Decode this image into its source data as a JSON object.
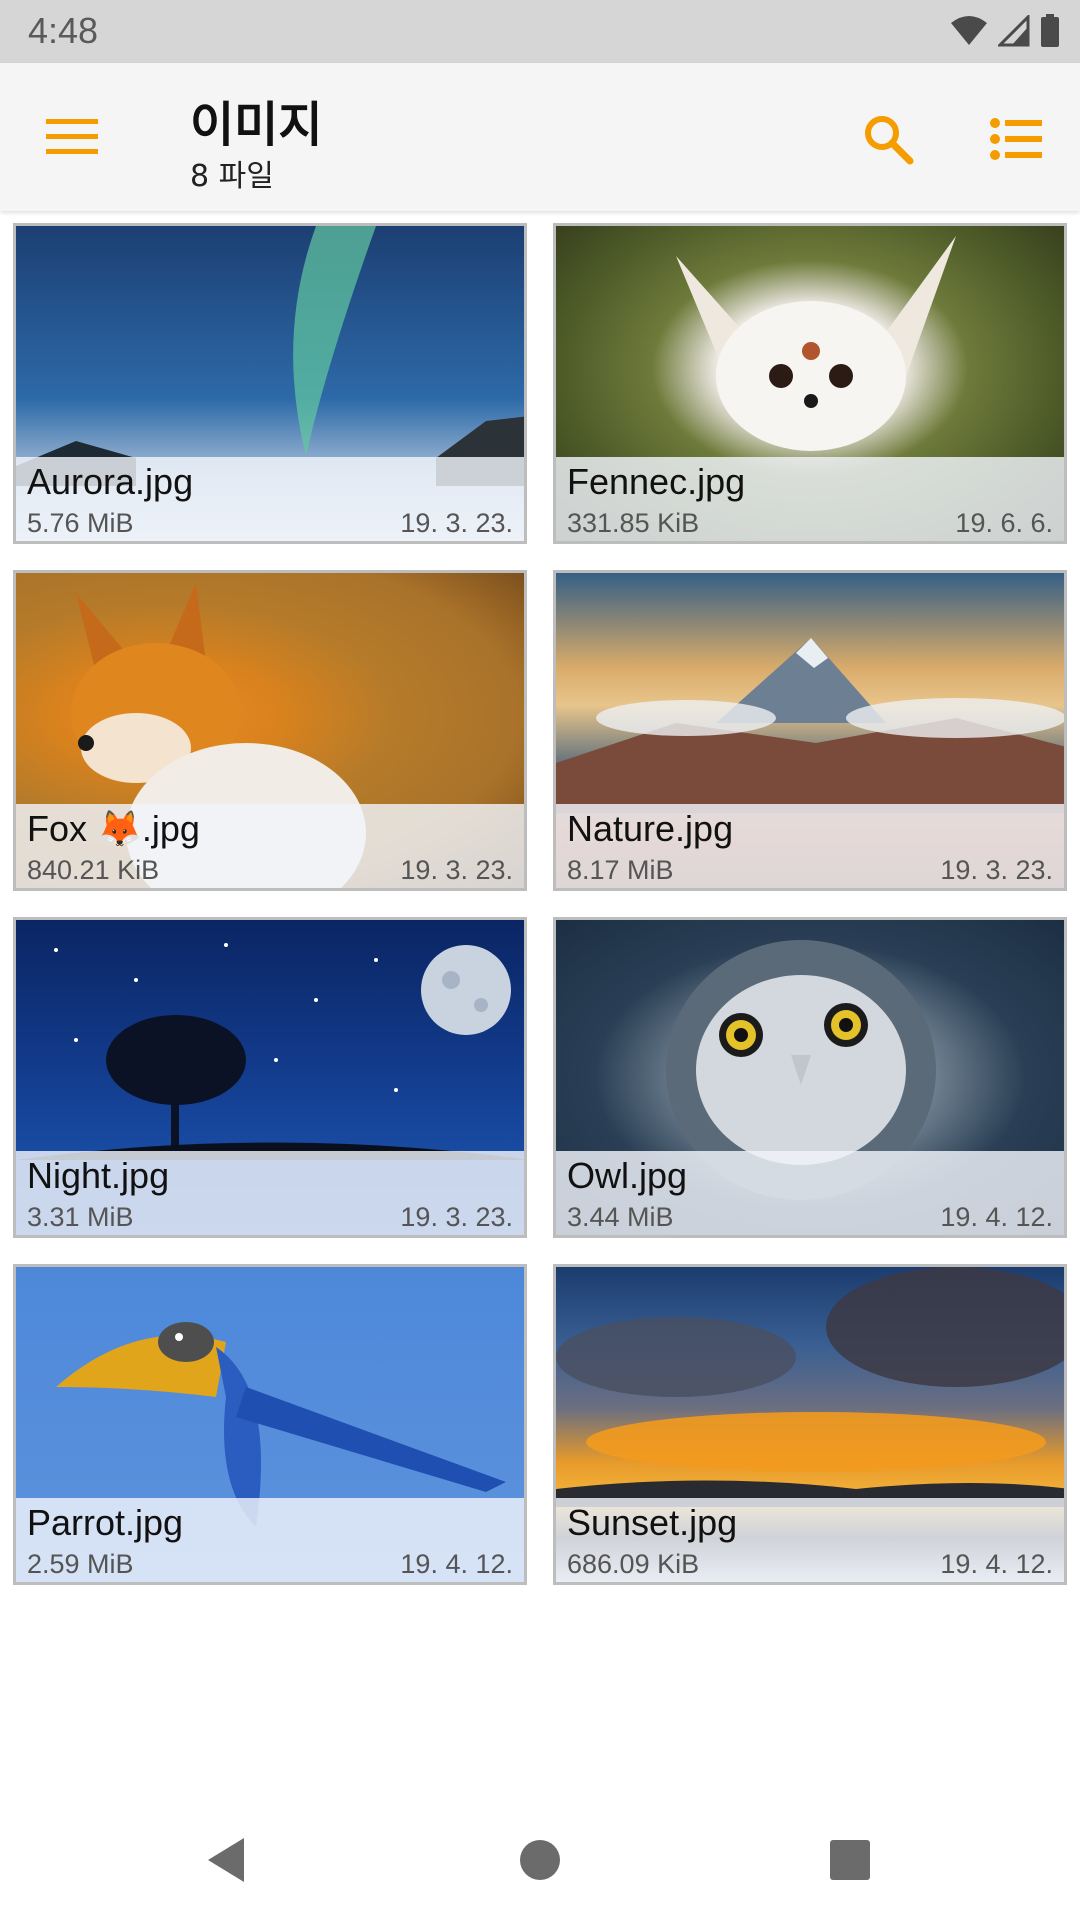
{
  "status_bar": {
    "time": "4:48",
    "icons": [
      "wifi-icon",
      "cell-signal-icon",
      "battery-icon"
    ]
  },
  "app_bar": {
    "title": "이미지",
    "subtitle": "8 파일",
    "accent_color": "#f59c00",
    "icons": [
      "menu-icon",
      "search-icon",
      "list-view-icon"
    ]
  },
  "files": [
    {
      "name": "Aurora.jpg",
      "size": "5.76 MiB",
      "date": "19. 3. 23.",
      "thumb": "aurora"
    },
    {
      "name": "Fennec.jpg",
      "size": "331.85 KiB",
      "date": "19. 6. 6.",
      "thumb": "fennec"
    },
    {
      "name": "Fox 🦊.jpg",
      "size": "840.21 KiB",
      "date": "19. 3. 23.",
      "thumb": "fox"
    },
    {
      "name": "Nature.jpg",
      "size": "8.17 MiB",
      "date": "19. 3. 23.",
      "thumb": "nature"
    },
    {
      "name": "Night.jpg",
      "size": "3.31 MiB",
      "date": "19. 3. 23.",
      "thumb": "night"
    },
    {
      "name": "Owl.jpg",
      "size": "3.44 MiB",
      "date": "19. 4. 12.",
      "thumb": "owl"
    },
    {
      "name": "Parrot.jpg",
      "size": "2.59 MiB",
      "date": "19. 4. 12.",
      "thumb": "parrot"
    },
    {
      "name": "Sunset.jpg",
      "size": "686.09 KiB",
      "date": "19. 4. 12.",
      "thumb": "sunset"
    }
  ],
  "nav_bar": {
    "icons": [
      "back-icon",
      "home-icon",
      "recents-icon"
    ]
  }
}
